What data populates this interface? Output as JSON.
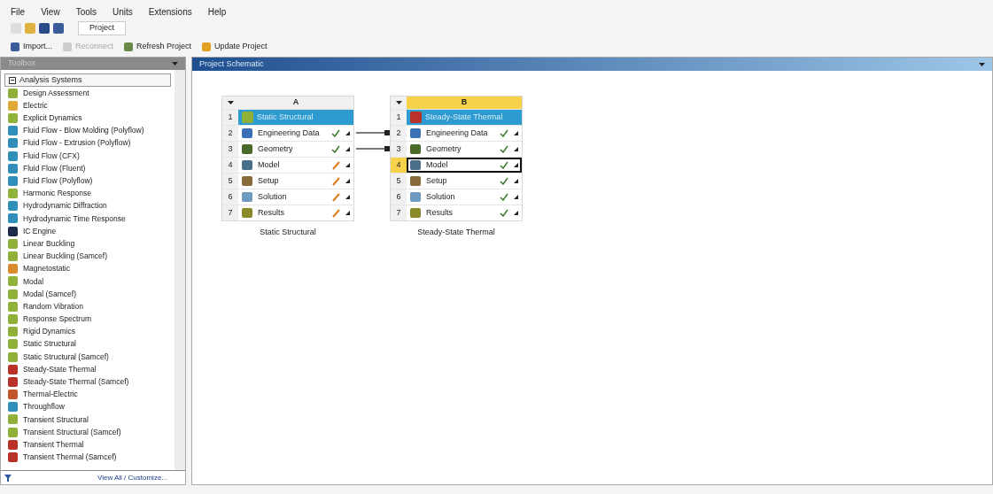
{
  "menu": [
    "File",
    "View",
    "Tools",
    "Units",
    "Extensions",
    "Help"
  ],
  "tabs": [
    {
      "label": "Project",
      "selected": true
    }
  ],
  "toolbar": [
    {
      "label": "Import...",
      "disabled": false
    },
    {
      "label": "Reconnect",
      "disabled": true
    },
    {
      "label": "Refresh Project",
      "disabled": false
    },
    {
      "label": "Update Project",
      "disabled": false
    }
  ],
  "toolbox": {
    "title": "Toolbox",
    "group": {
      "label": "Analysis Systems",
      "expanded": true
    },
    "items": [
      {
        "label": "Design Assessment",
        "color": "#8fb13a"
      },
      {
        "label": "Electric",
        "color": "#e0a93a"
      },
      {
        "label": "Explicit Dynamics",
        "color": "#8fb13a"
      },
      {
        "label": "Fluid Flow - Blow Molding (Polyflow)",
        "color": "#2f8fb8"
      },
      {
        "label": "Fluid Flow - Extrusion (Polyflow)",
        "color": "#2f8fb8"
      },
      {
        "label": "Fluid Flow (CFX)",
        "color": "#2f8fb8"
      },
      {
        "label": "Fluid Flow (Fluent)",
        "color": "#2f8fb8"
      },
      {
        "label": "Fluid Flow (Polyflow)",
        "color": "#2f8fb8"
      },
      {
        "label": "Harmonic Response",
        "color": "#8fb13a"
      },
      {
        "label": "Hydrodynamic Diffraction",
        "color": "#2f8fb8"
      },
      {
        "label": "Hydrodynamic Time Response",
        "color": "#2f8fb8"
      },
      {
        "label": "IC Engine",
        "color": "#1e2a4a"
      },
      {
        "label": "Linear Buckling",
        "color": "#8fb13a"
      },
      {
        "label": "Linear Buckling (Samcef)",
        "color": "#8fb13a"
      },
      {
        "label": "Magnetostatic",
        "color": "#d98a2b"
      },
      {
        "label": "Modal",
        "color": "#8fb13a"
      },
      {
        "label": "Modal (Samcef)",
        "color": "#8fb13a"
      },
      {
        "label": "Random Vibration",
        "color": "#8fb13a"
      },
      {
        "label": "Response Spectrum",
        "color": "#8fb13a"
      },
      {
        "label": "Rigid Dynamics",
        "color": "#8fb13a"
      },
      {
        "label": "Static Structural",
        "color": "#8fb13a"
      },
      {
        "label": "Static Structural (Samcef)",
        "color": "#8fb13a"
      },
      {
        "label": "Steady-State Thermal",
        "color": "#b8322a"
      },
      {
        "label": "Steady-State Thermal (Samcef)",
        "color": "#b8322a"
      },
      {
        "label": "Thermal-Electric",
        "color": "#c2552a"
      },
      {
        "label": "Throughflow",
        "color": "#2f8fb8"
      },
      {
        "label": "Transient Structural",
        "color": "#8fb13a"
      },
      {
        "label": "Transient Structural (Samcef)",
        "color": "#8fb13a"
      },
      {
        "label": "Transient Thermal",
        "color": "#b8322a"
      },
      {
        "label": "Transient Thermal (Samcef)",
        "color": "#b8322a"
      }
    ],
    "footer_link": "View All / Customize..."
  },
  "schematic": {
    "title": "Project Schematic",
    "systems": [
      {
        "letter": "A",
        "selected": false,
        "num": "1",
        "name": "Static Structural",
        "caption": "Static Structural",
        "rows": [
          {
            "num": "2",
            "label": "Engineering Data",
            "kind": "ok",
            "selected": false
          },
          {
            "num": "3",
            "label": "Geometry",
            "kind": "ok",
            "selected": false
          },
          {
            "num": "4",
            "label": "Model",
            "kind": "update",
            "selected": false
          },
          {
            "num": "5",
            "label": "Setup",
            "kind": "update",
            "selected": false
          },
          {
            "num": "6",
            "label": "Solution",
            "kind": "update",
            "selected": false
          },
          {
            "num": "7",
            "label": "Results",
            "kind": "update",
            "selected": false
          }
        ]
      },
      {
        "letter": "B",
        "selected": true,
        "num": "1",
        "name": "Steady-State Thermal",
        "caption": "Steady-State Thermal",
        "rows": [
          {
            "num": "2",
            "label": "Engineering Data",
            "kind": "ok",
            "selected": false
          },
          {
            "num": "3",
            "label": "Geometry",
            "kind": "ok",
            "selected": false
          },
          {
            "num": "4",
            "label": "Model",
            "kind": "ok",
            "selected": true
          },
          {
            "num": "5",
            "label": "Setup",
            "kind": "ok",
            "selected": false
          },
          {
            "num": "6",
            "label": "Solution",
            "kind": "ok",
            "selected": false
          },
          {
            "num": "7",
            "label": "Results",
            "kind": "ok",
            "selected": false
          }
        ]
      }
    ],
    "links": [
      {
        "linked": true
      },
      {
        "linked": true
      },
      {
        "linked": false
      },
      {
        "linked": false
      },
      {
        "linked": false
      },
      {
        "linked": false
      }
    ]
  }
}
